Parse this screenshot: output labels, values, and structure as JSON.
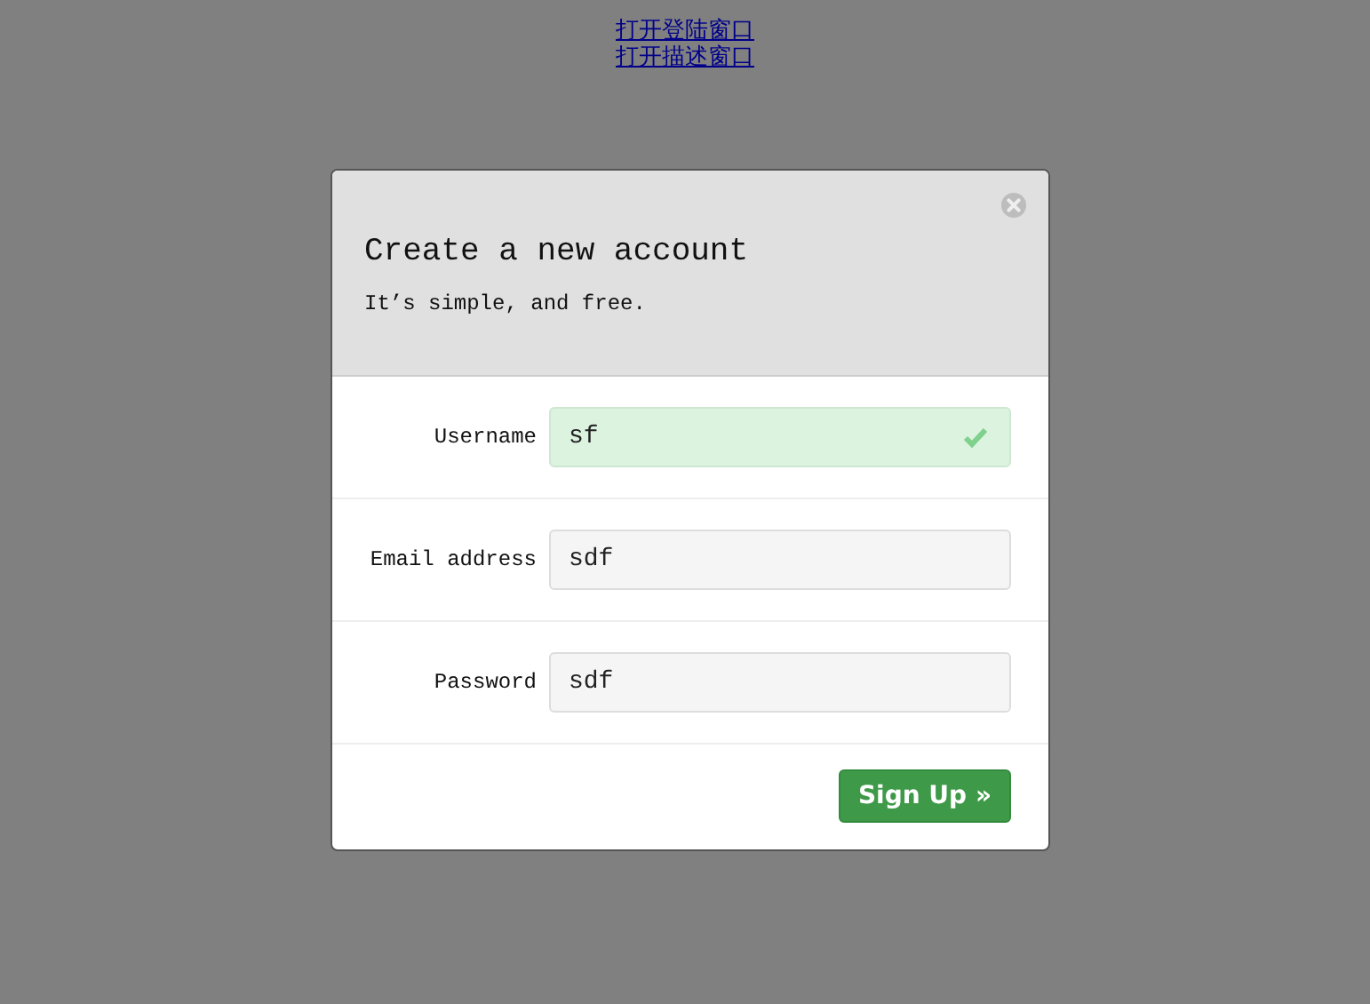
{
  "links": [
    "打开登陆窗口",
    "打开描述窗口"
  ],
  "modal": {
    "title": "Create a new account",
    "subtitle": "It’s simple, and free.",
    "fields": [
      {
        "label": "Username",
        "value": "sf",
        "valid": true
      },
      {
        "label": "Email address",
        "value": "sdf",
        "valid": false
      },
      {
        "label": "Password",
        "value": "sdf",
        "valid": false
      }
    ],
    "submit": "Sign Up »"
  }
}
